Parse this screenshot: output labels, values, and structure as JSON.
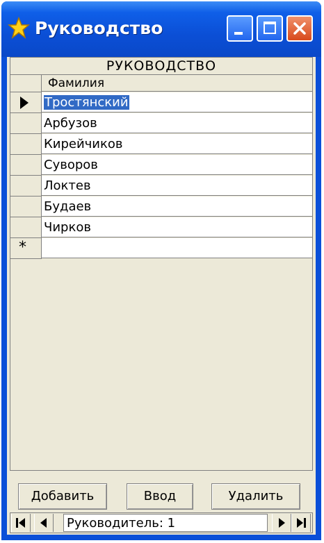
{
  "window": {
    "title": "Руководство",
    "accent": "#0a4fd8"
  },
  "icons": [
    "star-icon",
    "minimize-icon",
    "maximize-icon",
    "close-icon",
    "record-selector-arrow-icon",
    "new-record-star-icon",
    "first-record-icon",
    "previous-record-icon",
    "next-record-icon",
    "last-record-icon"
  ],
  "grid": {
    "caption": "РУКОВОДСТВО",
    "column_header": "Фамилия",
    "rows": [
      {
        "value": "Тростянский",
        "selected": true
      },
      {
        "value": "Арбузов"
      },
      {
        "value": "Кирейчиков"
      },
      {
        "value": "Суворов"
      },
      {
        "value": "Локтев"
      },
      {
        "value": "Будаев"
      },
      {
        "value": "Чирков"
      }
    ],
    "new_row_marker": "*",
    "selection_color": "#316ac5"
  },
  "buttons": {
    "add": "Добавить",
    "enter": "Ввод",
    "delete": "Удалить"
  },
  "navigation": {
    "label": "Руководитель: 1"
  }
}
